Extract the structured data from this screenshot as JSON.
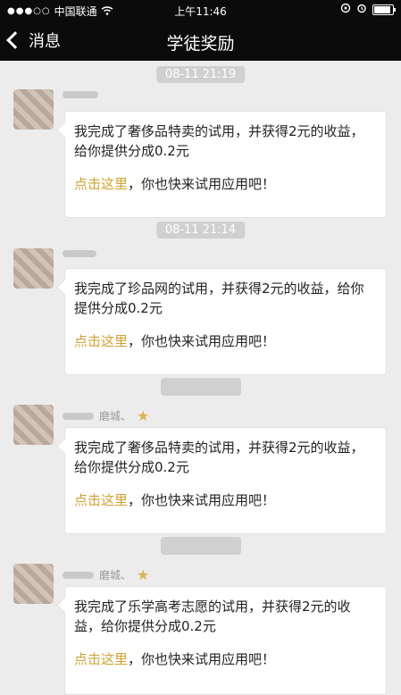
{
  "status": {
    "signal": "●●●○○",
    "carrier": "中国联通",
    "time": "上午11:46"
  },
  "nav": {
    "back_label": "消息",
    "title": "学徒奖励"
  },
  "messages": [
    {
      "timestamp": "08-11 21:19",
      "text": "我完成了奢侈品特卖的试用，并获得2元的收益，给你提供分成0.2元",
      "link": "点击这里",
      "tail": "，你也快来试用应用吧！"
    },
    {
      "timestamp": "08-11 21:14",
      "text": "我完成了珍品网的试用，并获得2元的收益，给你提供分成0.2元",
      "link": "点击这里",
      "tail": "，你也快来试用应用吧！"
    },
    {
      "timestamp": "",
      "name": "磨城、",
      "text": "我完成了奢侈品特卖的试用，并获得2元的收益，给你提供分成0.2元",
      "link": "点击这里",
      "tail": "，你也快来试用应用吧！"
    },
    {
      "timestamp": "",
      "name": "磨城、",
      "text": "我完成了乐学高考志愿的试用，并获得2元的收益，给你提供分成0.2元",
      "link": "点击这里",
      "tail": "，你也快来试用应用吧！"
    }
  ]
}
